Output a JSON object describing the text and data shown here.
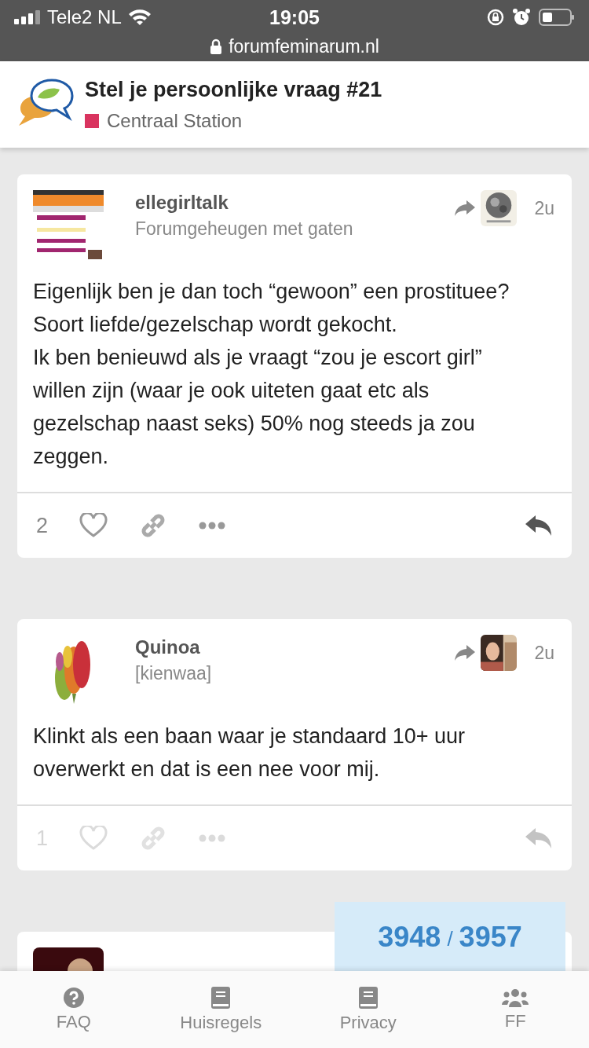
{
  "status_bar": {
    "carrier": "Tele2 NL",
    "time": "19:05",
    "url": "forumfeminarum.nl"
  },
  "topic": {
    "title": "Stel je persoonlijke vraag #21",
    "category": {
      "name": "Centraal Station",
      "color": "#d9345f"
    }
  },
  "posts": [
    {
      "username": "ellegirltalk",
      "user_title": "Forumgeheugen met gaten",
      "time": "2u",
      "paragraphs": [
        "Eigenlijk ben je dan toch “gewoon” een prostituee?",
        "Soort liefde/gezelschap wordt gekocht.",
        "Ik ben benieuwd als je vraagt “zou je escort girl” willen zijn (waar je ook uiteten gaat etc als gezelschap naast seks) 50% nog steeds ja zou zeggen."
      ],
      "like_count": "2",
      "dimmed": false
    },
    {
      "username": "Quinoa",
      "user_title": "[kienwaa]",
      "time": "2u",
      "paragraphs": [
        "Klinkt als een baan waar je standaard 10+ uur overwerkt en dat is een nee voor mij."
      ],
      "like_count": "1",
      "dimmed": true
    }
  ],
  "progress": {
    "current": "3948",
    "separator": "/",
    "total": "3957"
  },
  "nav": [
    {
      "label": "FAQ",
      "kind": "question"
    },
    {
      "label": "Huisregels",
      "kind": "book"
    },
    {
      "label": "Privacy",
      "kind": "book"
    },
    {
      "label": "FF",
      "kind": "users"
    }
  ]
}
